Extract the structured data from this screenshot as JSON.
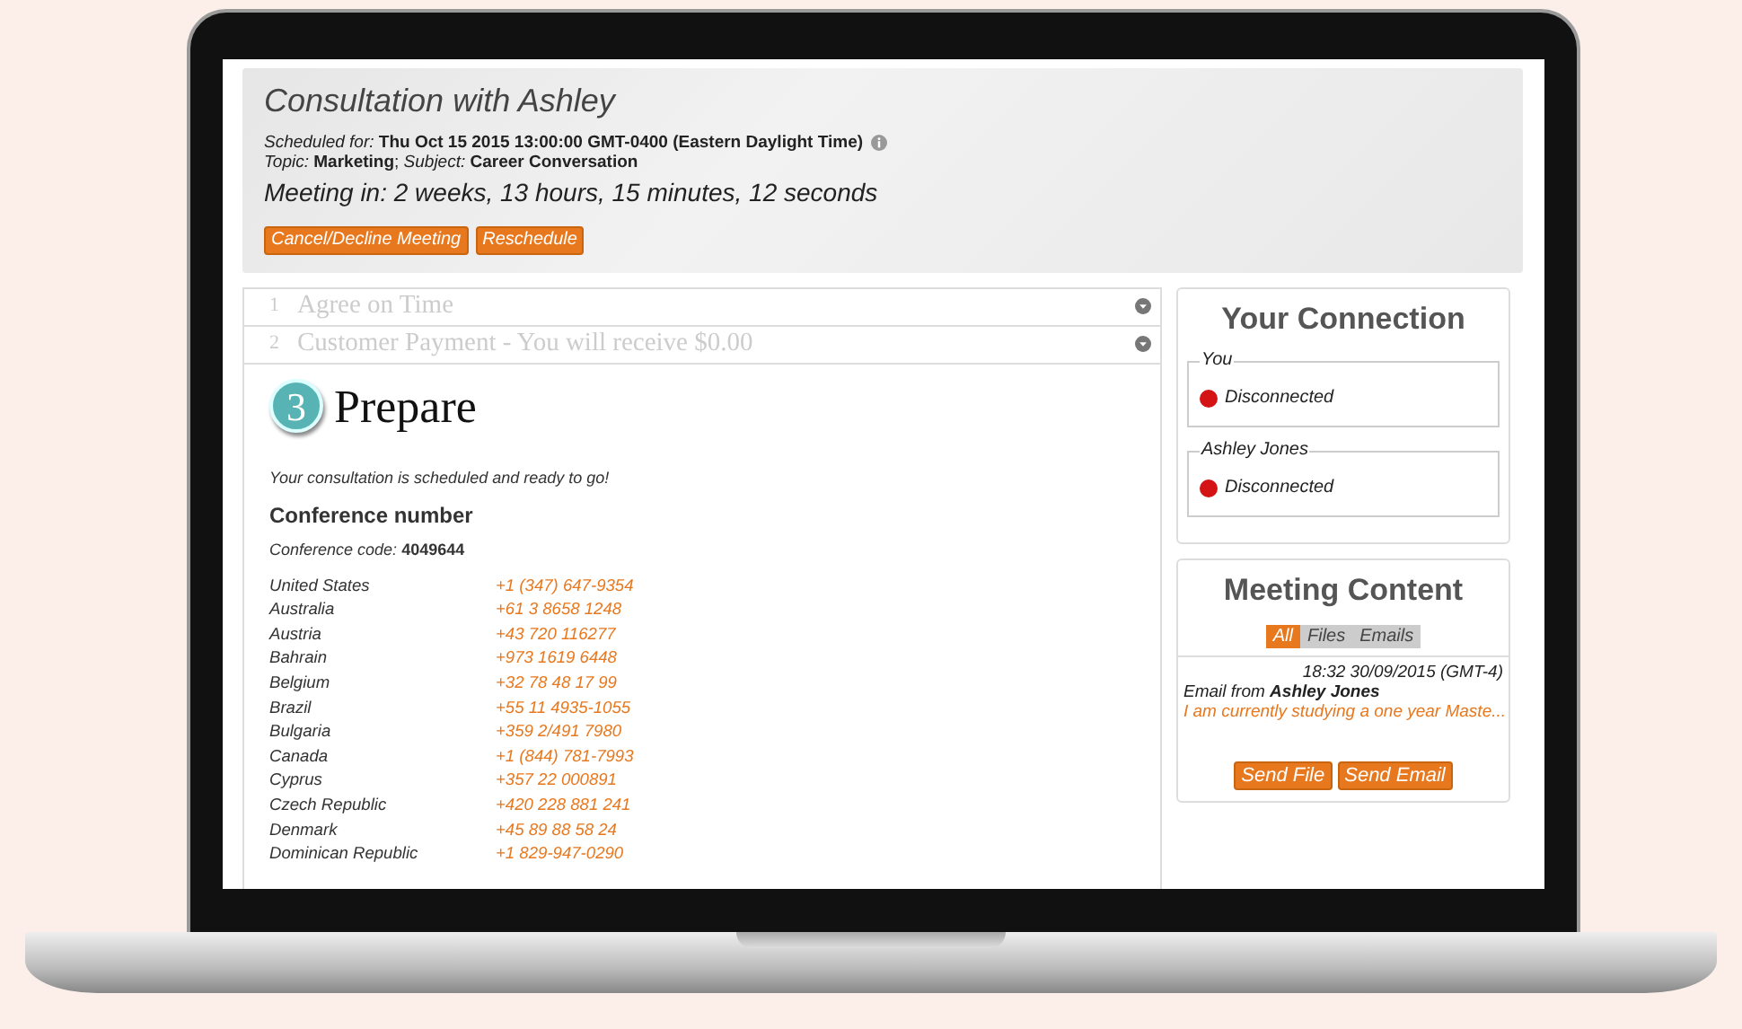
{
  "header": {
    "title": "Consultation with Ashley",
    "scheduled": "*Scheduled for:* **Thu Oct 15 2015 13:00:00 GMT-0400 (Eastern Daylight Time)**",
    "topic": "*Topic:* **Marketing**; *Subject:* **Career Conversation**",
    "countdown": "Meeting in: 2 weeks, 13 hours, 15 minutes, 12 seconds",
    "buttons": [
      "Cancel/Decline Meeting",
      "Reschedule"
    ]
  },
  "steps": [
    {
      "number": "1",
      "title": "Agree on Time",
      "expanded": false
    },
    {
      "number": "2",
      "title": "Customer Payment - You will receive $0.00",
      "expanded": false
    },
    {
      "number": "3",
      "title": "Prepare",
      "expanded": true
    }
  ],
  "prepare": {
    "message": "Your consultation is scheduled and ready to go!",
    "heading": "Conference number",
    "code": "*Conference code:* **4049644**",
    "numbers": [
      {
        "country": "United States",
        "phone": "+1 (347) 647-9354"
      },
      {
        "country": "Australia",
        "phone": "+61 3 8658 1248"
      },
      {
        "country": "Austria",
        "phone": "+43 720 116277"
      },
      {
        "country": "Bahrain",
        "phone": "+973 1619 6448"
      },
      {
        "country": "Belgium",
        "phone": "+32 78 48 17 99"
      },
      {
        "country": "Brazil",
        "phone": "+55 11 4935-1055"
      },
      {
        "country": "Bulgaria",
        "phone": "+359 2/491 7980"
      },
      {
        "country": "Canada",
        "phone": "+1 (844) 781-7993"
      },
      {
        "country": "Cyprus",
        "phone": "+357 22 000891"
      },
      {
        "country": "Czech Republic",
        "phone": "+420 228 881 241"
      },
      {
        "country": "Denmark",
        "phone": "+45 89 88 58 24"
      },
      {
        "country": "Dominican Republic",
        "phone": "+1 829-947-0290"
      }
    ]
  },
  "connection": {
    "title": "Your Connection",
    "participants": [
      {
        "name": "You",
        "status": "Disconnected",
        "color": "#d41414"
      },
      {
        "name": "Ashley Jones",
        "status": "Disconnected",
        "color": "#d41414"
      }
    ]
  },
  "meeting_content": {
    "title": "Meeting Content",
    "filters": [
      {
        "label": "All",
        "selected": true
      },
      {
        "label": "Files",
        "selected": false
      },
      {
        "label": "Emails",
        "selected": false
      }
    ],
    "items": [
      {
        "time": "18:32 30/09/2015 (GMT-4)",
        "from": "Email from **Ashley Jones**",
        "preview": "I am currently studying a one year Maste..."
      }
    ],
    "buttons": [
      "Send File",
      "Send Email"
    ]
  }
}
